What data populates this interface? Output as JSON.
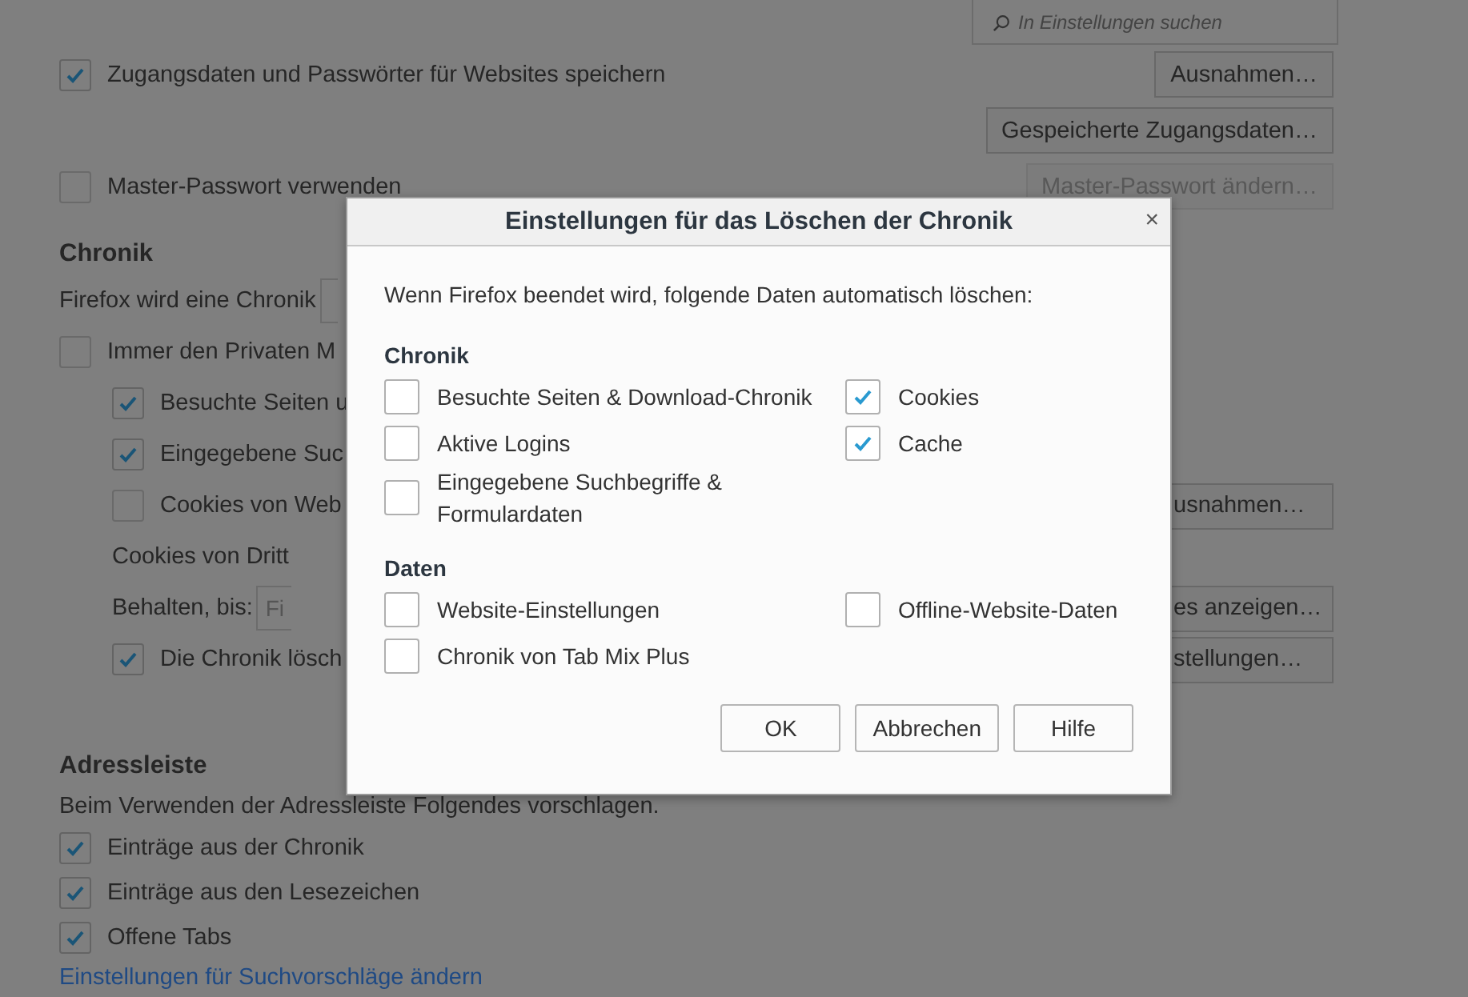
{
  "search": {
    "placeholder": "In Einstellungen suchen"
  },
  "top_rows": [
    {
      "kind": "checkbox",
      "label": "Zugangsdaten und Passwörter für Websites speichern",
      "checked": true,
      "button": {
        "label": "Ausnahmen…",
        "disabled": false
      }
    },
    {
      "kind": "button",
      "button": {
        "label": "Gespeicherte Zugangsdaten…",
        "disabled": false
      }
    },
    {
      "kind": "checkbox",
      "label": "Master-Passwort verwenden",
      "checked": false,
      "button": {
        "label": "Master-Passwort ändern…",
        "disabled": true
      }
    }
  ],
  "chronik": {
    "heading": "Chronik",
    "rows": [
      {
        "kind": "select",
        "label": "Firefox wird eine Chronik"
      },
      {
        "kind": "checkbox",
        "label": "Immer den Privaten M",
        "checked": false,
        "children": [
          {
            "kind": "checkbox",
            "label": "Besuchte Seiten u",
            "checked": true
          },
          {
            "kind": "checkbox",
            "label": "Eingegebene Suc",
            "checked": true
          },
          {
            "kind": "checkbox",
            "label": "Cookies von Web",
            "checked": false,
            "button": {
              "label": "usnahmen…",
              "disabled": false
            }
          },
          {
            "kind": "text",
            "label": "Cookies von Dritt"
          },
          {
            "kind": "select",
            "label": "Behalten, bis:",
            "value": "Fi",
            "button": {
              "label": "es anzeigen…",
              "disabled": false
            }
          },
          {
            "kind": "checkbox",
            "label": "Die Chronik lösch",
            "checked": true,
            "button": {
              "label": "stellungen…",
              "disabled": false
            }
          }
        ]
      }
    ]
  },
  "adressleiste": {
    "heading": "Adressleiste",
    "description": "Beim Verwenden der Adressleiste Folgendes vorschlagen.",
    "rows": [
      {
        "label": "Einträge aus der Chronik",
        "checked": true
      },
      {
        "label": "Einträge aus den Lesezeichen",
        "checked": true
      },
      {
        "label": "Offene Tabs",
        "checked": true
      }
    ],
    "link": "Einstellungen für Suchvorschläge ändern"
  },
  "dialog": {
    "title": "Einstellungen für das Löschen der Chronik",
    "close": "×",
    "intro": "Wenn Firefox beendet wird, folgende Daten automatisch löschen:",
    "groups": [
      {
        "heading": "Chronik",
        "columns": [
          [
            {
              "label": "Besuchte Seiten & Download-Chronik",
              "checked": false
            },
            {
              "label": "Aktive Logins",
              "checked": false
            },
            {
              "label": "Eingegebene Suchbegriffe & Formulardaten",
              "checked": false
            }
          ],
          [
            {
              "label": "Cookies",
              "checked": true
            },
            {
              "label": "Cache",
              "checked": true
            }
          ]
        ]
      },
      {
        "heading": "Daten",
        "columns": [
          [
            {
              "label": "Website-Einstellungen",
              "checked": false
            },
            {
              "label": "Chronik von Tab Mix Plus",
              "checked": false
            }
          ],
          [
            {
              "label": "Offline-Website-Daten",
              "checked": false
            }
          ]
        ]
      }
    ],
    "buttons": [
      "OK",
      "Abbrechen",
      "Hilfe"
    ]
  }
}
